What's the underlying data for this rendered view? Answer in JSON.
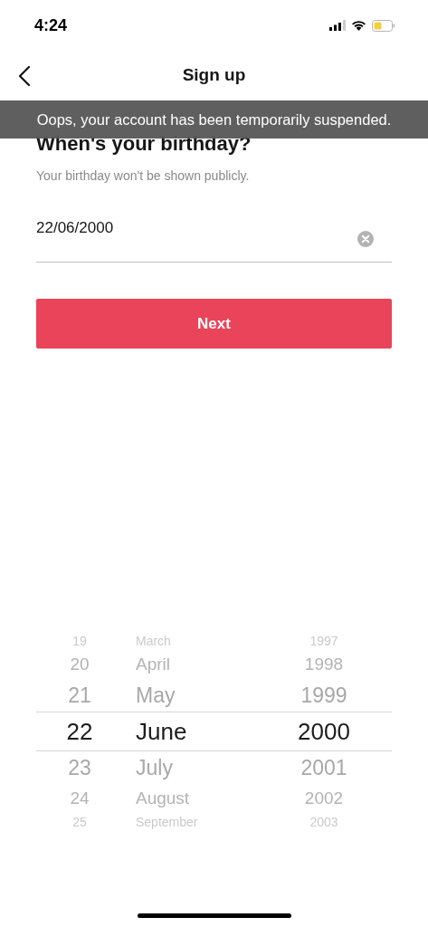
{
  "status_bar": {
    "time": "4:24"
  },
  "nav": {
    "title": "Sign up"
  },
  "toast": {
    "message": "Oops, your account has been temporarily suspended."
  },
  "heading": "When's your birthday?",
  "subtitle": "Your birthday won't be shown publicly.",
  "birthday_field": {
    "value": "22/06/2000"
  },
  "next_button": {
    "label": "Next"
  },
  "picker": {
    "days": [
      {
        "label": "19",
        "selected": false
      },
      {
        "label": "20",
        "selected": false
      },
      {
        "label": "21",
        "selected": false
      },
      {
        "label": "22",
        "selected": true
      },
      {
        "label": "23",
        "selected": false
      },
      {
        "label": "24",
        "selected": false
      },
      {
        "label": "25",
        "selected": false
      }
    ],
    "months": [
      {
        "label": "March",
        "selected": false
      },
      {
        "label": "April",
        "selected": false
      },
      {
        "label": "May",
        "selected": false
      },
      {
        "label": "June",
        "selected": true
      },
      {
        "label": "July",
        "selected": false
      },
      {
        "label": "August",
        "selected": false
      },
      {
        "label": "September",
        "selected": false
      }
    ],
    "years": [
      {
        "label": "1997",
        "selected": false
      },
      {
        "label": "1998",
        "selected": false
      },
      {
        "label": "1999",
        "selected": false
      },
      {
        "label": "2000",
        "selected": true
      },
      {
        "label": "2001",
        "selected": false
      },
      {
        "label": "2002",
        "selected": false
      },
      {
        "label": "2003",
        "selected": false
      }
    ]
  }
}
